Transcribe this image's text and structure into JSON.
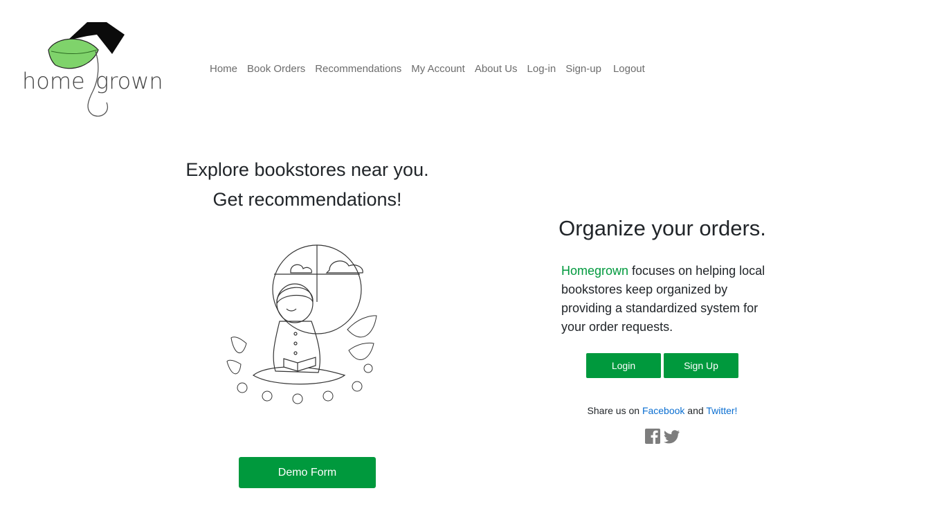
{
  "brand": {
    "logo_words": [
      "home",
      "grown"
    ],
    "green": "#00993d",
    "link_blue": "#0a6ed1"
  },
  "nav": {
    "items": [
      {
        "label": "Home"
      },
      {
        "label": "Book Orders"
      },
      {
        "label": "Recommendations"
      },
      {
        "label": "My Account"
      },
      {
        "label": "About Us"
      },
      {
        "label": "Log-in"
      },
      {
        "label": "Sign-up"
      },
      {
        "label": "Logout"
      }
    ]
  },
  "hero": {
    "line1": "Explore bookstores near you.",
    "line2": "Get recommendations!",
    "illustration": "child-reading-book-illustration",
    "demo_button": "Demo Form"
  },
  "info": {
    "title": "Organize your orders.",
    "brand_word": "Homegrown",
    "description": " focuses on helping local bookstores keep organized by providing a standardized system for your order requests.",
    "login_button": "Login",
    "signup_button": "Sign Up"
  },
  "share": {
    "prefix": "Share us on ",
    "facebook": "Facebook",
    "and": " and ",
    "twitter": "Twitter!",
    "icons": [
      "facebook-icon",
      "twitter-icon"
    ]
  }
}
